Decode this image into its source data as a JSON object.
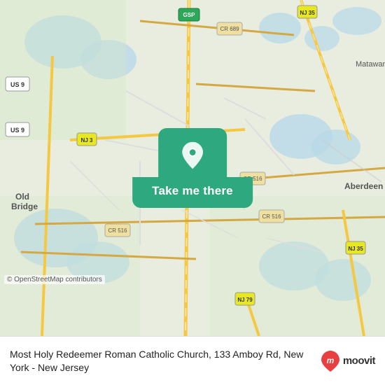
{
  "map": {
    "attribution": "© OpenStreetMap contributors",
    "center_lat": 40.43,
    "center_lng": -74.27
  },
  "button": {
    "label": "Take me there"
  },
  "location": {
    "name": "Most Holy Redeemer Roman Catholic Church, 133 Amboy Rd, New York - New Jersey"
  },
  "moovit": {
    "logo_text": "moovit"
  },
  "icons": {
    "pin": "location-pin-icon",
    "moovit_marker": "moovit-marker-icon"
  }
}
